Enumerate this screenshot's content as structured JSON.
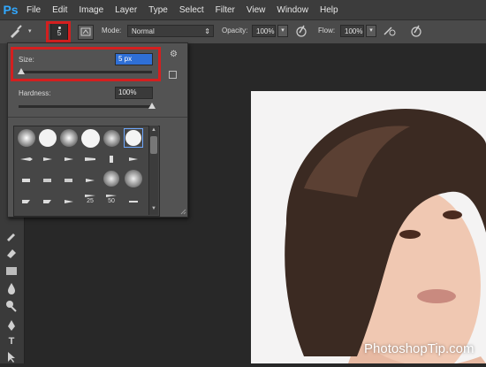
{
  "app": {
    "logo": "Ps"
  },
  "menu": [
    "File",
    "Edit",
    "Image",
    "Layer",
    "Type",
    "Select",
    "Filter",
    "View",
    "Window",
    "Help"
  ],
  "options": {
    "brush_size": "5",
    "mode_label": "Mode:",
    "mode_value": "Normal",
    "opacity_label": "Opacity:",
    "opacity_value": "100%",
    "flow_label": "Flow:",
    "flow_value": "100%"
  },
  "brush_picker": {
    "size_label": "Size:",
    "size_value": "5 px",
    "hardness_label": "Hardness:",
    "hardness_value": "100%",
    "size_slider": 0.02,
    "hardness_slider": 1.0,
    "grid_labels": [
      "25",
      "50"
    ]
  },
  "watermark": "PhotoshopTip.com",
  "icons": [
    "brush-icon",
    "settings-gear-icon",
    "airbrush-icon",
    "pressure-icon"
  ],
  "colors": {
    "highlight": "#d41f1f",
    "selection": "#2f6fd6"
  }
}
